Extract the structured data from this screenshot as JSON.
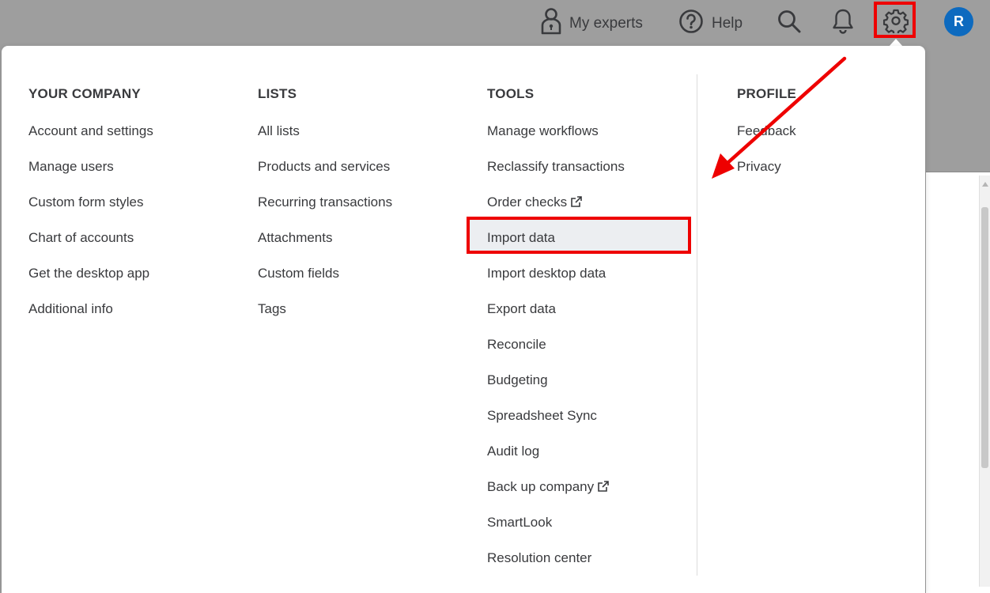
{
  "topbar": {
    "my_experts": "My experts",
    "help": "Help",
    "avatar_initial": "R"
  },
  "menu": {
    "your_company": {
      "heading": "YOUR COMPANY",
      "items": [
        "Account and settings",
        "Manage users",
        "Custom form styles",
        "Chart of accounts",
        "Get the desktop app",
        "Additional info"
      ]
    },
    "lists": {
      "heading": "LISTS",
      "items": [
        "All lists",
        "Products and services",
        "Recurring transactions",
        "Attachments",
        "Custom fields",
        "Tags"
      ]
    },
    "tools": {
      "heading": "TOOLS",
      "items": [
        "Manage workflows",
        "Reclassify transactions",
        "Order checks",
        "Import data",
        "Import desktop data",
        "Export data",
        "Reconcile",
        "Budgeting",
        "Spreadsheet Sync",
        "Audit log",
        "Back up company",
        "SmartLook",
        "Resolution center"
      ]
    },
    "profile": {
      "heading": "PROFILE",
      "items": [
        "Feedback",
        "Privacy"
      ]
    }
  },
  "colors": {
    "annotation_red": "#ee0000",
    "avatar_blue": "#0d6abf",
    "text": "#393a3d"
  },
  "icons": [
    "person-lock-icon",
    "help-icon",
    "search-icon",
    "bell-icon",
    "gear-icon",
    "external-link-icon"
  ]
}
